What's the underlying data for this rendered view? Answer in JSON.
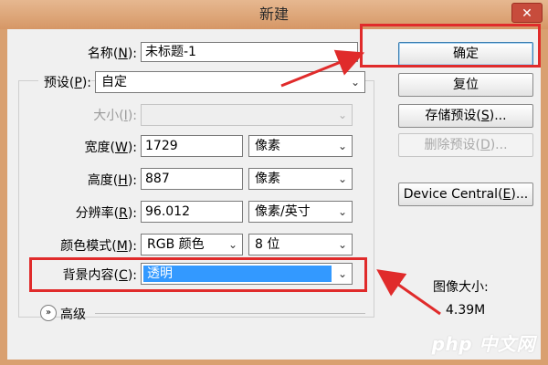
{
  "window": {
    "title": "新建",
    "close_glyph": "✕"
  },
  "form": {
    "name_label": "名称(",
    "name_key": "N",
    "name_label_end": "):",
    "name_value": "未标题-1",
    "preset_label": "预设(",
    "preset_key": "P",
    "preset_label_end": "):",
    "preset_value": "自定",
    "size_label": "大小(",
    "size_key": "I",
    "size_label_end": "):",
    "size_value": "",
    "width_label": "宽度(",
    "width_key": "W",
    "width_label_end": "):",
    "width_value": "1729",
    "width_unit": "像素",
    "height_label": "高度(",
    "height_key": "H",
    "height_label_end": "):",
    "height_value": "887",
    "height_unit": "像素",
    "resolution_label": "分辨率(",
    "resolution_key": "R",
    "resolution_label_end": "):",
    "resolution_value": "96.012",
    "resolution_unit": "像素/英寸",
    "color_mode_label": "颜色模式(",
    "color_mode_key": "M",
    "color_mode_label_end": "):",
    "color_mode_value": "RGB 颜色",
    "bit_depth_value": "8 位",
    "background_label": "背景内容(",
    "background_key": "C",
    "background_label_end": "):",
    "background_value": "透明",
    "advanced_label": "高级",
    "advanced_icon": "»"
  },
  "buttons": {
    "ok": "确定",
    "reset": "复位",
    "save_preset_pre": "存储预设(",
    "save_preset_key": "S",
    "save_preset_post": ")...",
    "delete_preset_pre": "删除预设(",
    "delete_preset_key": "D",
    "delete_preset_post": ")...",
    "device_central_pre": "Device Central(",
    "device_central_key": "E",
    "device_central_post": ")..."
  },
  "info": {
    "image_size_label": "图像大小:",
    "image_size_value": "4.39M"
  },
  "chevron_glyph": "⌄",
  "watermark": "php 中文网",
  "colors": {
    "title_bar": "#dba06f",
    "annotation_red": "#e02b2b",
    "selection_blue": "#3399ff"
  },
  "icons": [
    "close-icon",
    "chevron-down-icon",
    "advanced-expand-icon",
    "arrow-annotation"
  ]
}
